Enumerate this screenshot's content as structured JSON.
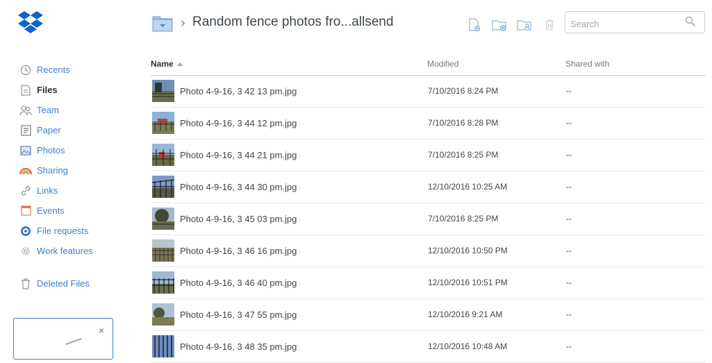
{
  "sidebar": {
    "items": [
      {
        "label": "Recents",
        "icon": "clock-icon",
        "active": false
      },
      {
        "label": "Files",
        "icon": "file-icon",
        "active": true
      },
      {
        "label": "Team",
        "icon": "team-icon",
        "active": false
      },
      {
        "label": "Paper",
        "icon": "paper-icon",
        "active": false
      },
      {
        "label": "Photos",
        "icon": "photos-icon",
        "active": false
      },
      {
        "label": "Sharing",
        "icon": "rainbow-icon",
        "active": false
      },
      {
        "label": "Links",
        "icon": "link-icon",
        "active": false
      },
      {
        "label": "Events",
        "icon": "calendar-icon",
        "active": false
      },
      {
        "label": "File requests",
        "icon": "file-request-icon",
        "active": false
      },
      {
        "label": "Work features",
        "icon": "gear-icon",
        "active": false
      }
    ],
    "deleted_label": "Deleted Files",
    "promo_close": "×"
  },
  "header": {
    "breadcrumb_separator": "›",
    "title": "Random fence photos fro...allsend",
    "search_placeholder": "Search"
  },
  "table": {
    "columns": {
      "name": "Name",
      "modified": "Modified",
      "shared": "Shared with"
    },
    "rows": [
      {
        "name": "Photo 4-9-16, 3 42 13 pm.jpg",
        "modified": "7/10/2016 8:24 PM",
        "shared": "--"
      },
      {
        "name": "Photo 4-9-16, 3 44 12 pm.jpg",
        "modified": "7/10/2016 8:28 PM",
        "shared": "--"
      },
      {
        "name": "Photo 4-9-16, 3 44 21 pm.jpg",
        "modified": "7/10/2016 8:25 PM",
        "shared": "--"
      },
      {
        "name": "Photo 4-9-16, 3 44 30 pm.jpg",
        "modified": "12/10/2016 10:25 AM",
        "shared": "--"
      },
      {
        "name": "Photo 4-9-16, 3 45 03 pm.jpg",
        "modified": "7/10/2016 8:25 PM",
        "shared": "--"
      },
      {
        "name": "Photo 4-9-16, 3 46 16 pm.jpg",
        "modified": "12/10/2016 10:50 PM",
        "shared": "--"
      },
      {
        "name": "Photo 4-9-16, 3 46 40 pm.jpg",
        "modified": "12/10/2016 10:51 PM",
        "shared": "--"
      },
      {
        "name": "Photo 4-9-16, 3 47 55 pm.jpg",
        "modified": "12/10/2016 9:21 AM",
        "shared": "--"
      },
      {
        "name": "Photo 4-9-16, 3 48 35 pm.jpg",
        "modified": "12/10/2016 10:48 AM",
        "shared": "--"
      }
    ]
  },
  "colors": {
    "brand_blue": "#0061fe",
    "link_blue": "#3d7fc8",
    "text_dark": "#3d464d",
    "muted": "#6f7a82"
  }
}
